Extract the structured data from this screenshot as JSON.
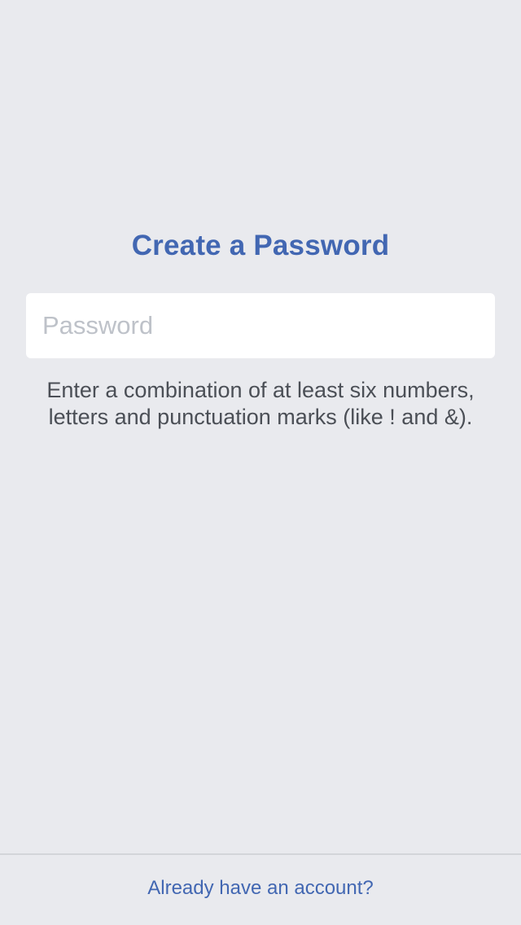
{
  "page": {
    "title": "Create a Password",
    "password_field": {
      "placeholder": "Password",
      "value": ""
    },
    "hint": "Enter a combination of at least six numbers, letters and punctuation marks (like ! and &).",
    "footer_link": "Already have an account?"
  },
  "colors": {
    "background": "#e9eaee",
    "accent": "#4267b2",
    "hint_text": "#4b4f56",
    "placeholder": "#bec2c9"
  }
}
